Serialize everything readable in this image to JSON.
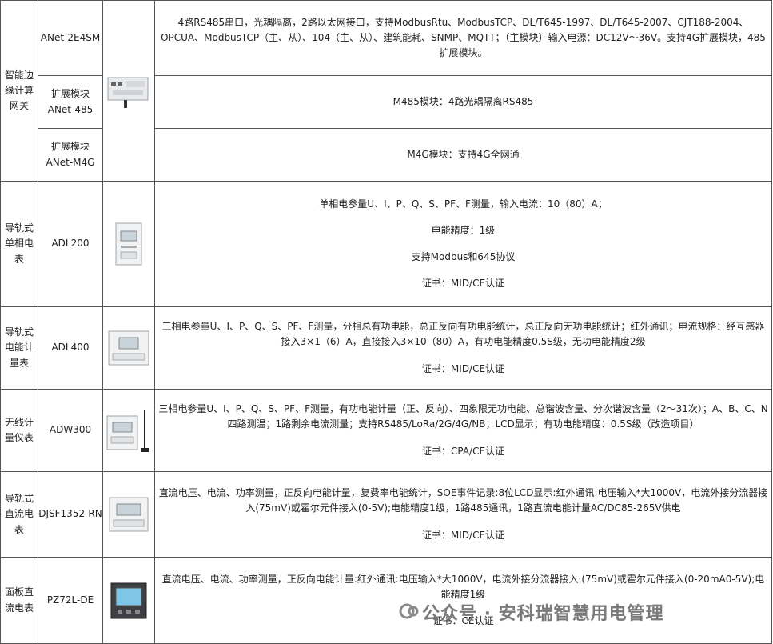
{
  "rows": [
    {
      "category": "智能边缘计算网关",
      "model": "ANet-2E4SM",
      "description": [
        "4路RS485串口，光耦隔离，2路以太网接口，支持ModbusRtu、ModbusTCP、DL/T645-1997、DL/T645-2007、CJT188-2004、OPCUA、ModbusTCP（主、从）、104（主、从）、建筑能耗、SNMP、MQTT；（主模块）输入电源：DC12V～36V。支持4G扩展模块，485扩展模块。"
      ]
    },
    {
      "model": "扩展模块ANet-485",
      "description": [
        "M485模块：4路光耦隔离RS485"
      ]
    },
    {
      "model": "扩展模块ANet-M4G",
      "description": [
        "M4G模块：支持4G全网通"
      ]
    },
    {
      "category": "导轨式单相电表",
      "model": "ADL200",
      "description": [
        "单相电参量U、I、P、Q、S、PF、F测量，输入电流：10（80）A；",
        "电能精度：1级",
        "支持Modbus和645协议",
        "证书：MID/CE认证"
      ]
    },
    {
      "category": "导轨式电能计量表",
      "model": "ADL400",
      "description": [
        "三相电参量U、I、P、Q、S、PF、F测量，分相总有功电能，总正反向有功电能统计，总正反向无功电能统计；红外通讯；电流规格：经互感器接入3×1（6）A，直接接入3×10（80）A，有功电能精度0.5S级，无功电能精度2级",
        "证书：MID/CE认证"
      ]
    },
    {
      "category": "无线计量仪表",
      "model": "ADW300",
      "description": [
        "三相电参量U、I、P、Q、S、PF、F测量，有功电能计量（正、反向）、四象限无功电能、总谐波含量、分次谐波含量（2～31次）；A、B、C、N四路测温；1路剩余电流测量；支持RS485/LoRa/2G/4G/NB；LCD显示；有功电能精度：0.5S级（改造项目）",
        "证书：CPA/CE认证"
      ]
    },
    {
      "category": "导轨式直流电表",
      "model": "DJSF1352-RN",
      "description": [
        "直流电压、电流、功率测量，正反向电能计量，复费率电能统计，SOE事件记录:8位LCD显示:红外通讯:电压输入*大1000V，电流外接分流器接入(75mV)或霍尔元件接入(0-5V);电能精度1级，1路485通讯，1路直流电能计量AC/DC85-265V供电",
        "证书：MID/CE认证"
      ]
    },
    {
      "category": "面板直流电表",
      "model": "PZ72L-DE",
      "description": [
        "直流电压、电流、功率测量，正反向电能计量:红外通讯:电压输入*大1000V，电流外接分流器接入·(75mV)或霍尔元件接入(0-20mA0-5V);电能精度1级",
        "证书：CE认证"
      ]
    }
  ],
  "watermark": {
    "text": "公众号 · 安科瑞智慧用电管理",
    "icon": "wechat-official-account-icon"
  }
}
